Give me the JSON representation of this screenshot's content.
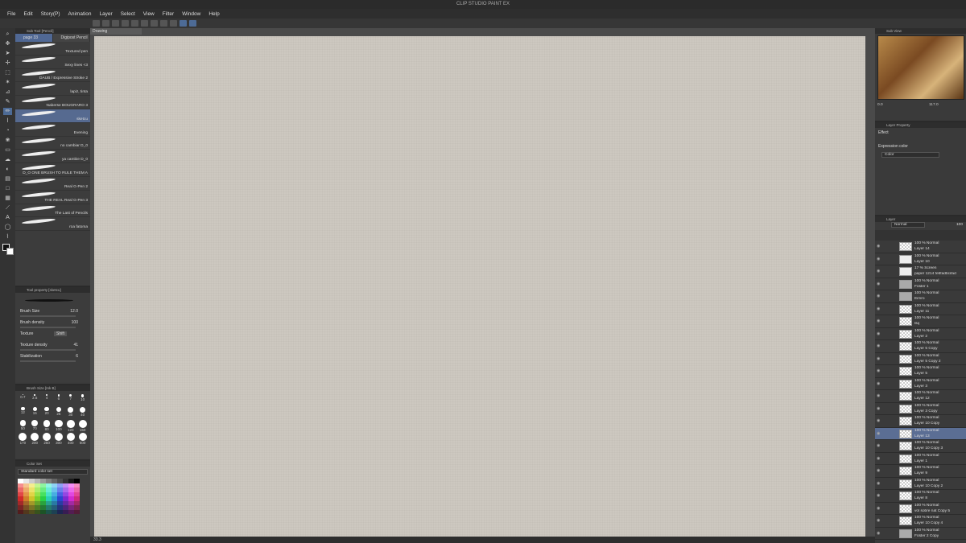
{
  "app": {
    "title": "CLIP STUDIO PAINT EX"
  },
  "menu": [
    "File",
    "Edit",
    "Story(P)",
    "Animation",
    "Layer",
    "Select",
    "View",
    "Filter",
    "Window",
    "Help"
  ],
  "subtool": {
    "title": "Sub Tool [Pencil]",
    "tabs": [
      "page 33",
      "Digipost Pencil"
    ],
    "brushes": [
      "Textured pen",
      "Sexy lines <3",
      "DAUB / Expressive Stroke 2",
      "lapiz, tinta",
      "Naberse BOUGRARO 3",
      "sketcu",
      "Evening",
      "no cambiar D_0",
      "ya cambie D_0",
      "D_O ONE BRUSH TO RULE THEM A",
      "Real G-Pen 2",
      "THE REAL Real G-Pen 3",
      "The Last of Pencils",
      "roa fatoma"
    ],
    "selected_index": 5
  },
  "tool_property": {
    "title": "Tool property [sketcu]",
    "brush_size_label": "Brush Size",
    "brush_size_value": "12.0",
    "brush_density_label": "Brush density",
    "brush_density_value": "100",
    "texture_label": "Texture",
    "texture_value": "Shift",
    "texture_density_label": "Texture density",
    "texture_density_value": "41",
    "stabilization_label": "Stabilization",
    "stabilization_value": "6"
  },
  "brush_size_panel": {
    "title": "Brush Size [Ink B]",
    "sizes": [
      "0.7",
      "2.5",
      "4",
      "6",
      "7",
      "10",
      "12",
      "15",
      "20",
      "25",
      "30",
      "40",
      "50",
      "70",
      "80",
      "100",
      "120",
      "150",
      "170",
      "200",
      "250",
      "300",
      "400",
      "500"
    ]
  },
  "color_set": {
    "title": "Color Set",
    "selected": "Standard color set"
  },
  "canvas": {
    "tab_label": "Drawing",
    "zoom": "33.3"
  },
  "navigator": {
    "title": "Sub View",
    "zoom": "117.0",
    "angle": "0.0"
  },
  "layer_property": {
    "title": "Layer Property",
    "effect_label": "Effect",
    "expression_label": "Expression color",
    "expression_value": "Color"
  },
  "layer_panel": {
    "title": "Layer",
    "blend_mode": "Normal",
    "opacity": "100",
    "layers": [
      {
        "mode": "100 % Normal",
        "name": "Layer 14",
        "thumb": "checker"
      },
      {
        "mode": "100 % Normal",
        "name": "Layer 10",
        "thumb": "white"
      },
      {
        "mode": "17 % Screen",
        "name": "paper 1214 fe6fadbcifad",
        "thumb": "white"
      },
      {
        "mode": "100 % Normal",
        "name": "Folder 1",
        "thumb": "folder"
      },
      {
        "mode": "100 % Normal",
        "name": "Eimro",
        "thumb": "folder"
      },
      {
        "mode": "100 % Normal",
        "name": "Layer 11",
        "thumb": "checker"
      },
      {
        "mode": "100 % Normal",
        "name": "lsq",
        "thumb": "checker"
      },
      {
        "mode": "100 % Normal",
        "name": "Layer 2",
        "thumb": "checker"
      },
      {
        "mode": "100 % Normal",
        "name": "Layer 5 Copy",
        "thumb": "checker"
      },
      {
        "mode": "100 % Normal",
        "name": "Layer 5 Copy 2",
        "thumb": "checker"
      },
      {
        "mode": "100 % Normal",
        "name": "Layer 5",
        "thumb": "checker"
      },
      {
        "mode": "100 % Normal",
        "name": "Layer 3",
        "thumb": "checker"
      },
      {
        "mode": "100 % Normal",
        "name": "Layer 12",
        "thumb": "checker"
      },
      {
        "mode": "100 % Normal",
        "name": "Layer 3 Copy",
        "thumb": "checker"
      },
      {
        "mode": "100 % Normal",
        "name": "Layer 10 Copy",
        "thumb": "checker"
      },
      {
        "mode": "100 % Normal",
        "name": "Layer 13",
        "thumb": "checker"
      },
      {
        "mode": "100 % Normal",
        "name": "Layer 10 Copy 3",
        "thumb": "checker"
      },
      {
        "mode": "100 % Normal",
        "name": "Layer 1",
        "thumb": "checker"
      },
      {
        "mode": "100 % Normal",
        "name": "Layer 9",
        "thumb": "checker"
      },
      {
        "mode": "100 % Normal",
        "name": "Layer 10 Copy 2",
        "thumb": "checker"
      },
      {
        "mode": "100 % Normal",
        "name": "Layer 8",
        "thumb": "checker"
      },
      {
        "mode": "100 % Normal",
        "name": "vol sobre nat  Copy 5",
        "thumb": "checker"
      },
      {
        "mode": "100 % Normal",
        "name": "Layer 10 Copy 4",
        "thumb": "checker"
      },
      {
        "mode": "100 % Normal",
        "name": "Folder 2 Copy",
        "thumb": "folder"
      }
    ],
    "selected_index": 15
  },
  "colors": {
    "accent": "#4d6b96",
    "selected_row": "#5b6e94",
    "paper": "#cdc8c0"
  }
}
